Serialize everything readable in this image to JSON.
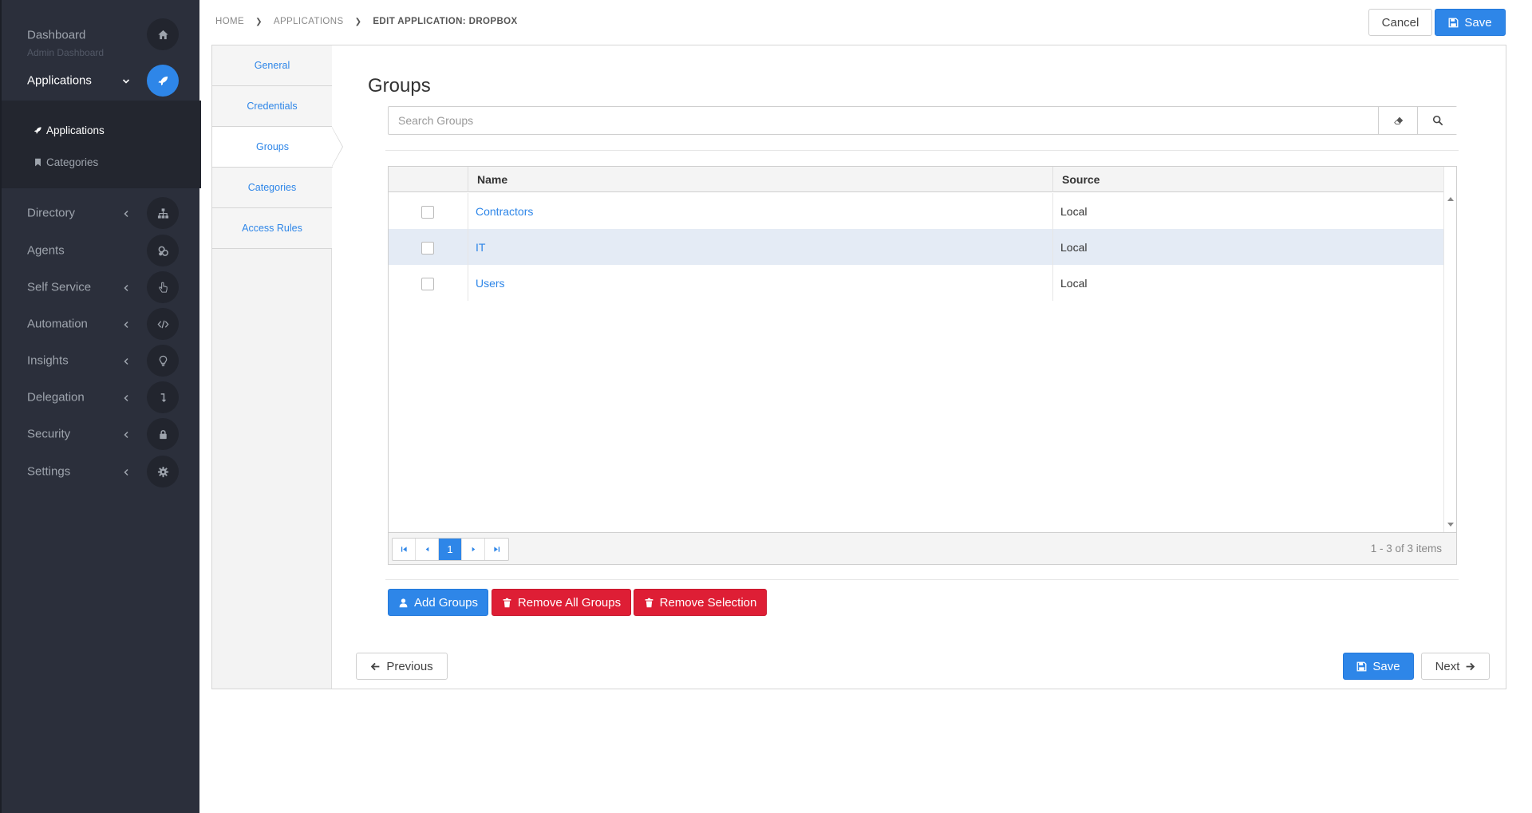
{
  "sidebar": {
    "dashboard": {
      "label": "Dashboard",
      "sub": "Admin Dashboard"
    },
    "applications": {
      "label": "Applications"
    },
    "subnav": [
      {
        "label": "Applications"
      },
      {
        "label": "Categories"
      }
    ],
    "items": [
      {
        "label": "Directory",
        "icon": "sitemap-icon",
        "chevron": true
      },
      {
        "label": "Agents",
        "icon": "agents-icon",
        "chevron": false
      },
      {
        "label": "Self Service",
        "icon": "hand-pointer-icon",
        "chevron": true
      },
      {
        "label": "Automation",
        "icon": "code-icon",
        "chevron": true
      },
      {
        "label": "Insights",
        "icon": "lightbulb-icon",
        "chevron": true
      },
      {
        "label": "Delegation",
        "icon": "level-down-icon",
        "chevron": true
      },
      {
        "label": "Security",
        "icon": "lock-icon",
        "chevron": true
      },
      {
        "label": "Settings",
        "icon": "gear-icon",
        "chevron": true
      }
    ]
  },
  "breadcrumb": {
    "home": "HOME",
    "applications": "APPLICATIONS",
    "current": "EDIT APPLICATION: DROPBOX"
  },
  "topbar": {
    "cancel": "Cancel",
    "save": "Save"
  },
  "tabs": [
    {
      "label": "General"
    },
    {
      "label": "Credentials"
    },
    {
      "label": "Groups"
    },
    {
      "label": "Categories"
    },
    {
      "label": "Access Rules"
    }
  ],
  "groups": {
    "title": "Groups",
    "search_placeholder": "Search Groups",
    "columns": {
      "name": "Name",
      "source": "Source"
    },
    "rows": [
      {
        "name": "Contractors",
        "source": "Local"
      },
      {
        "name": "IT",
        "source": "Local"
      },
      {
        "name": "Users",
        "source": "Local"
      }
    ],
    "pager": {
      "current_page": "1",
      "info": "1 - 3 of 3 items"
    }
  },
  "actions": {
    "add": "Add Groups",
    "remove_all": "Remove All Groups",
    "remove_selection": "Remove Selection"
  },
  "footer": {
    "previous": "Previous",
    "save": "Save",
    "next": "Next"
  },
  "colors": {
    "primary": "#2e86e8",
    "danger": "#de1e35",
    "sidebar": "#2b2f3b",
    "selected_row": "#e4ebf5"
  }
}
